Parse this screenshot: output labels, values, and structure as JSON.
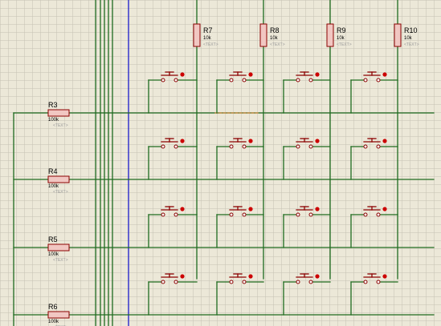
{
  "colors": {
    "background": "#ece8d8",
    "grid": "#c5c1b2",
    "wire": "#1f6b1f",
    "blue_wire": "#1a1acc",
    "component_outline": "#8b0000",
    "component_fill": "#f1c7c2",
    "pin_dot": "#cc0000",
    "highlight_wire": "#d08a3a"
  },
  "row_resistors": [
    {
      "ref": "R3",
      "value": "100k",
      "text": "<TEXT>"
    },
    {
      "ref": "R4",
      "value": "100k",
      "text": "<TEXT>"
    },
    {
      "ref": "R5",
      "value": "100k",
      "text": "<TEXT>"
    },
    {
      "ref": "R6",
      "value": "100k",
      "text": "<TEXT>"
    }
  ],
  "column_resistors": [
    {
      "ref": "R7",
      "value": "10k",
      "text": "<TEXT>"
    },
    {
      "ref": "R8",
      "value": "10k",
      "text": "<TEXT>"
    },
    {
      "ref": "R9",
      "value": "10k",
      "text": "<TEXT>"
    },
    {
      "ref": "R10",
      "value": "10k",
      "text": "<TEXT>"
    }
  ],
  "switch_matrix": {
    "rows": 4,
    "cols": 4
  }
}
